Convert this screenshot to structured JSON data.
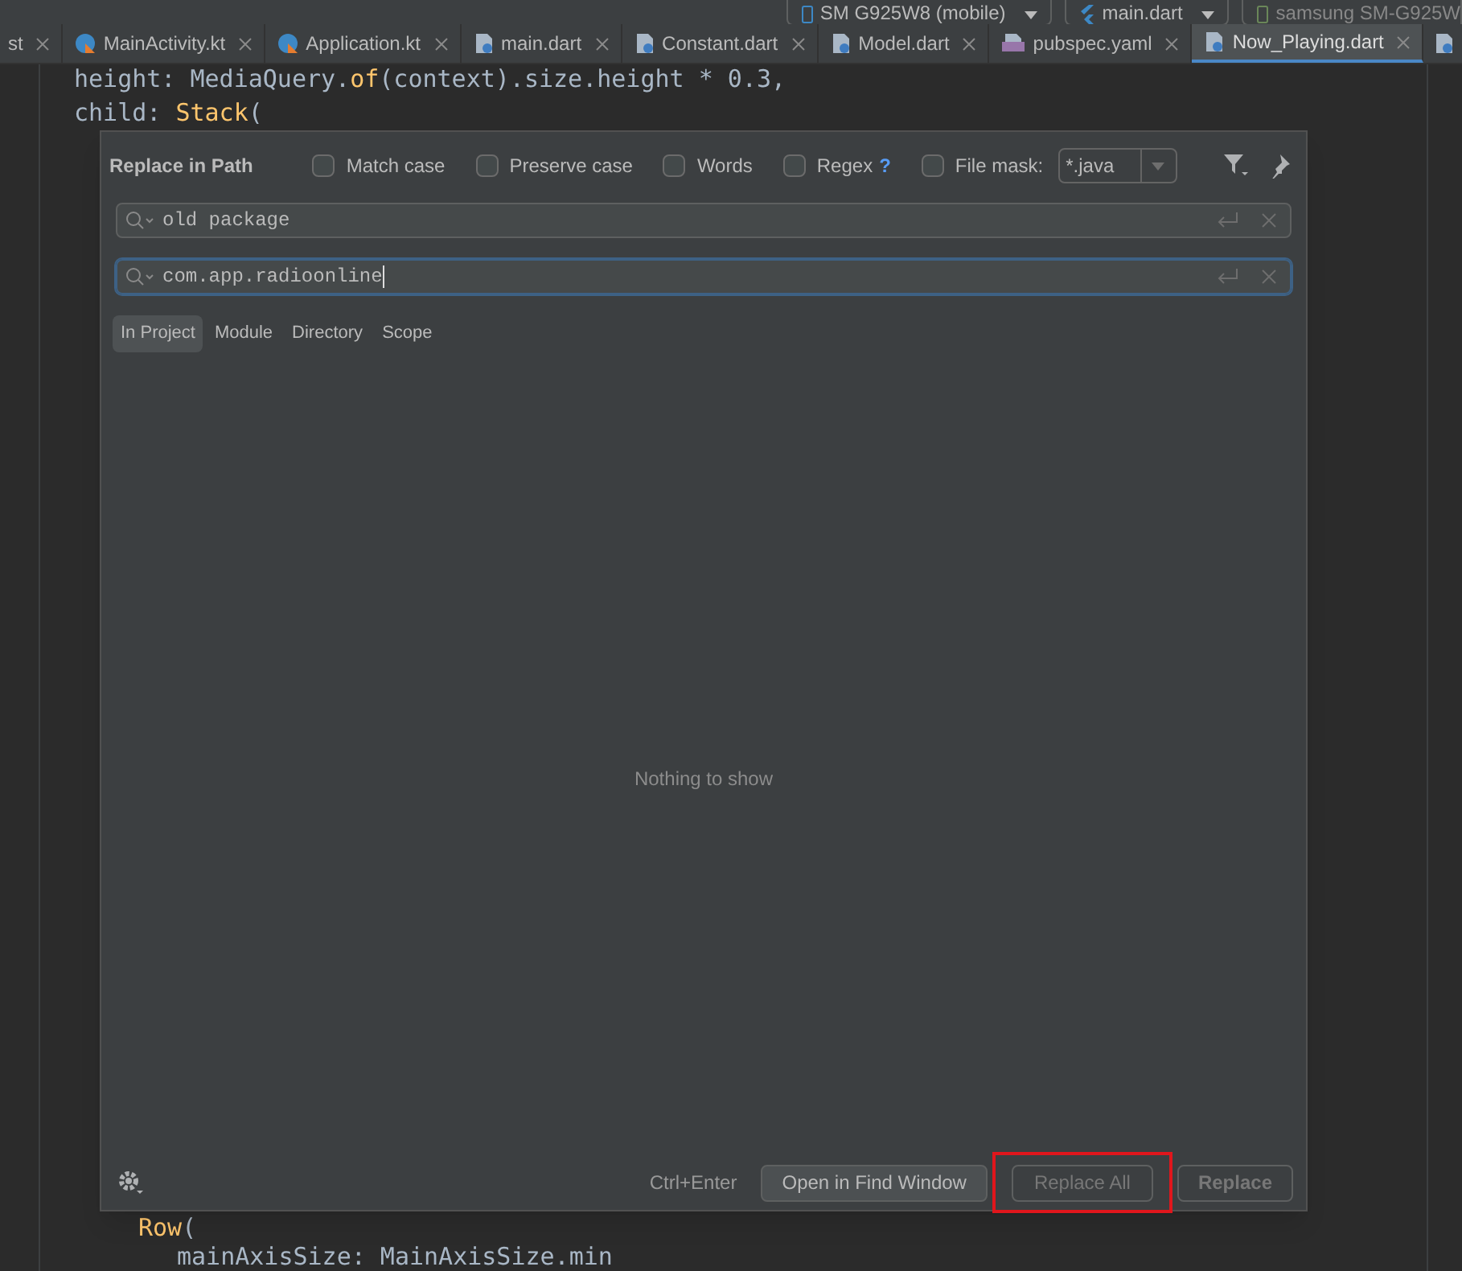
{
  "run_toolbar": {
    "device": "SM G925W8 (mobile)",
    "config": "main.dart",
    "target": "samsung SM-G925W"
  },
  "tabs": [
    {
      "label": "st",
      "kind": "cut",
      "selected": false
    },
    {
      "label": "MainActivity.kt",
      "kind": "kotlin",
      "selected": false
    },
    {
      "label": "Application.kt",
      "kind": "kotlin",
      "selected": false
    },
    {
      "label": "main.dart",
      "kind": "dart",
      "selected": false
    },
    {
      "label": "Constant.dart",
      "kind": "dart",
      "selected": false
    },
    {
      "label": "Model.dart",
      "kind": "dart",
      "selected": false
    },
    {
      "label": "pubspec.yaml",
      "kind": "yaml",
      "selected": false
    },
    {
      "label": "Now_Playing.dart",
      "kind": "dart",
      "selected": true
    }
  ],
  "code_top": [
    {
      "plain": "height: MediaQuery.",
      "accent": "of",
      "rest": "(context).size.height * 0.3,"
    },
    {
      "plain": "child: ",
      "accent": "Stack",
      "rest": "("
    }
  ],
  "code_bottom": [
    {
      "accent": "Row",
      "rest": "("
    },
    {
      "plain": "mainAxisSize: MainAxisSize.min"
    }
  ],
  "dialog": {
    "title": "Replace in Path",
    "options": [
      {
        "label": "Match case",
        "checked": false
      },
      {
        "label": "Preserve case",
        "checked": false
      },
      {
        "label": "Words",
        "checked": false
      },
      {
        "label": "Regex",
        "checked": false,
        "help": "?"
      }
    ],
    "file_mask": {
      "label": "File mask:",
      "checked": false,
      "value": "*.java"
    },
    "search": {
      "value": "old package",
      "focused": false
    },
    "replace": {
      "value": "com.app.radioonline",
      "focused": true
    },
    "scopes": [
      {
        "label": "In Project",
        "selected": true
      },
      {
        "label": "Module",
        "selected": false
      },
      {
        "label": "Directory",
        "selected": false
      },
      {
        "label": "Scope",
        "selected": false
      }
    ],
    "empty_text": "Nothing to show",
    "shortcut": "Ctrl+Enter",
    "buttons": [
      {
        "label": "Open in Find Window",
        "disabled": false,
        "highlighted": false
      },
      {
        "label": "Replace All",
        "disabled": true,
        "highlighted": true
      },
      {
        "label": "Replace",
        "disabled": true,
        "highlighted": false
      }
    ]
  }
}
